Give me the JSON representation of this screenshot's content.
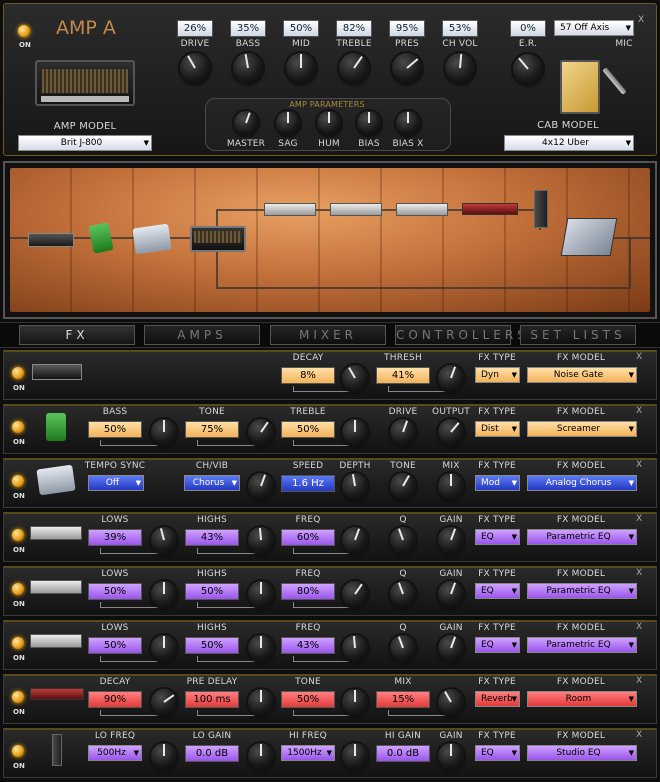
{
  "amp": {
    "title": "AMP A",
    "on_label": "ON",
    "controls": [
      {
        "label": "DRIVE",
        "value": "26%"
      },
      {
        "label": "BASS",
        "value": "35%"
      },
      {
        "label": "MID",
        "value": "50%"
      },
      {
        "label": "TREBLE",
        "value": "82%"
      },
      {
        "label": "PRES",
        "value": "95%"
      },
      {
        "label": "CH VOL",
        "value": "53%"
      }
    ],
    "params_title": "AMP PARAMETERS",
    "params": [
      "MASTER",
      "SAG",
      "HUM",
      "BIAS",
      "BIAS X"
    ],
    "model_label": "AMP MODEL",
    "model_value": "Brit J-800",
    "er_label": "E.R.",
    "er_value": "0%",
    "mic_label": "MIC",
    "mic_position": "57 Off Axis",
    "cab_label": "CAB MODEL",
    "cab_value": "4x12 Uber",
    "close": "X"
  },
  "tabs": [
    "FX",
    "AMPS",
    "MIXER",
    "CONTROLLERS",
    "SET LISTS"
  ],
  "fx_rows": [
    {
      "on": "ON",
      "close": "X",
      "icon": "noise-gate-icon",
      "color": "o",
      "controls": [
        {
          "label": "DECAY",
          "value": "8%"
        },
        {
          "label": "THRESH",
          "value": "41%"
        }
      ],
      "type": "Dyn",
      "model": "Noise Gate"
    },
    {
      "on": "ON",
      "close": "X",
      "icon": "green-pedal-icon",
      "color": "o",
      "controls": [
        {
          "label": "BASS",
          "value": "50%"
        },
        {
          "label": "TONE",
          "value": "75%"
        },
        {
          "label": "TREBLE",
          "value": "50%"
        }
      ],
      "plain": [
        "DRIVE",
        "OUTPUT"
      ],
      "type": "Dist",
      "model": "Screamer"
    },
    {
      "on": "ON",
      "close": "X",
      "icon": "chorus-pedal-icon",
      "color": "b",
      "tempo_label": "TEMPO SYNC",
      "tempo_value": "Off",
      "chvib_label": "CH/VIB",
      "chvib_value": "Chorus",
      "speed_label": "SPEED",
      "speed_value": "1.6 Hz",
      "plain": [
        "DEPTH",
        "TONE",
        "MIX"
      ],
      "type": "Mod",
      "model": "Analog Chorus"
    },
    {
      "on": "ON",
      "close": "X",
      "icon": "rack-eq-icon",
      "color": "p",
      "controls": [
        {
          "label": "LOWS",
          "value": "39%"
        },
        {
          "label": "HIGHS",
          "value": "43%"
        },
        {
          "label": "FREQ",
          "value": "60%"
        }
      ],
      "plain": [
        "Q",
        "GAIN"
      ],
      "type": "EQ",
      "model": "Parametric EQ"
    },
    {
      "on": "ON",
      "close": "X",
      "icon": "rack-eq-icon",
      "color": "p",
      "controls": [
        {
          "label": "LOWS",
          "value": "50%"
        },
        {
          "label": "HIGHS",
          "value": "50%"
        },
        {
          "label": "FREQ",
          "value": "80%"
        }
      ],
      "plain": [
        "Q",
        "GAIN"
      ],
      "type": "EQ",
      "model": "Parametric EQ"
    },
    {
      "on": "ON",
      "close": "X",
      "icon": "rack-eq-icon",
      "color": "p",
      "controls": [
        {
          "label": "LOWS",
          "value": "50%"
        },
        {
          "label": "HIGHS",
          "value": "50%"
        },
        {
          "label": "FREQ",
          "value": "43%"
        }
      ],
      "plain": [
        "Q",
        "GAIN"
      ],
      "type": "EQ",
      "model": "Parametric EQ"
    },
    {
      "on": "ON",
      "close": "X",
      "icon": "reverb-unit-icon",
      "color": "r",
      "controls": [
        {
          "label": "DECAY",
          "value": "90%"
        },
        {
          "label": "PRE DELAY",
          "value": "100 ms"
        },
        {
          "label": "TONE",
          "value": "50%"
        },
        {
          "label": "MIX",
          "value": "15%"
        }
      ],
      "type": "Reverb",
      "model": "Room"
    },
    {
      "on": "ON",
      "close": "X",
      "icon": "studio-eq-icon",
      "color": "p",
      "lofreq_label": "LO FREQ",
      "lofreq_value": "500Hz",
      "logain_label": "LO GAIN",
      "logain_value": "0.0 dB",
      "hifreq_label": "HI FREQ",
      "hifreq_value": "1500Hz",
      "higain_label": "HI GAIN",
      "higain_value": "0.0 dB",
      "plain": [
        "GAIN"
      ],
      "type": "EQ",
      "model": "Studio EQ"
    }
  ],
  "fx_type_label": "FX TYPE",
  "fx_model_label": "FX MODEL"
}
